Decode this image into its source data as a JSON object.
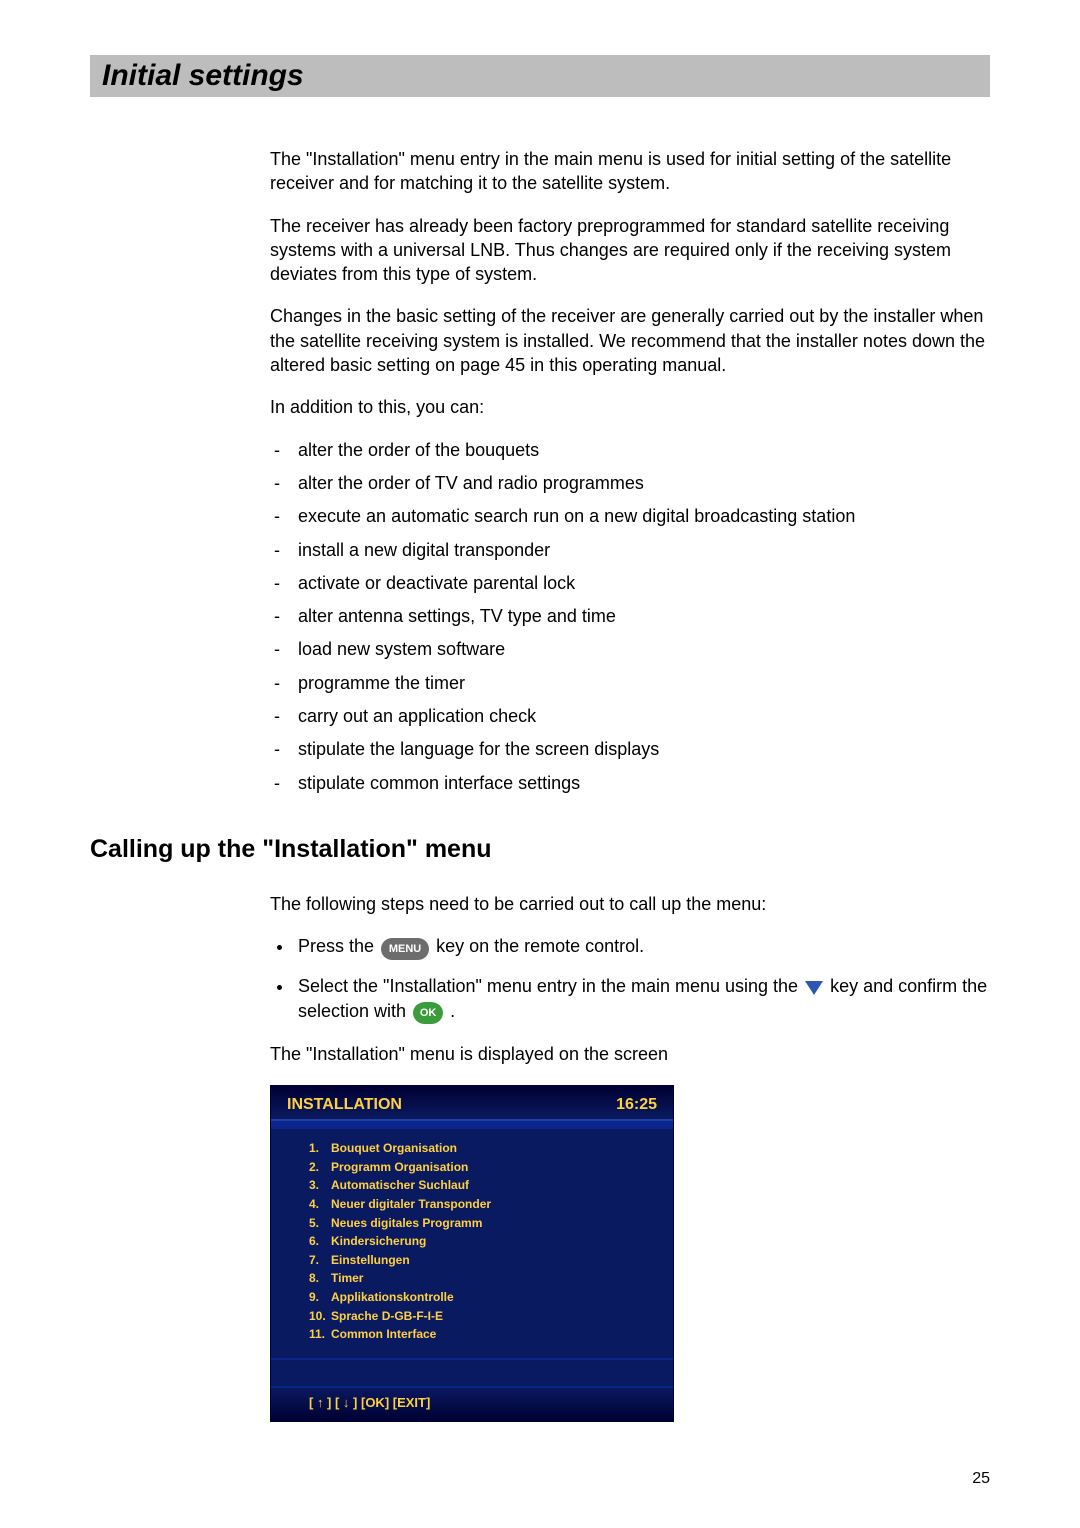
{
  "page": {
    "title": "Initial settings",
    "number": "25"
  },
  "intro": {
    "p1": "The \"Installation\" menu entry in the main menu is used for initial setting of the satellite receiver and for matching it to the satellite system.",
    "p2": "The receiver has already been factory preprogrammed for standard satellite receiving systems with a universal LNB. Thus changes are required only if the receiving system deviates from this type of system.",
    "p3": "Changes in the basic setting of the receiver are generally carried out by the installer when the satellite receiving system is installed. We recommend that the installer notes down the altered basic setting on page 45 in this operating manual.",
    "p4": "In addition to this, you can:"
  },
  "options": [
    "alter the order of the bouquets",
    "alter the order of TV and radio programmes",
    "execute an automatic search run on a new digital broadcasting station",
    "install a new digital transponder",
    "activate or deactivate parental lock",
    "alter antenna settings, TV type and time",
    "load new system software",
    "programme the timer",
    "carry out an application check",
    "stipulate the language for the screen displays",
    "stipulate common interface settings"
  ],
  "calling": {
    "heading": "Calling up the \"Installation\" menu",
    "intro": "The following steps need to be carried out to call up the menu:",
    "step1_a": "Press the ",
    "step1_b": " key on the remote control.",
    "step2_a": "Select the \"Installation\" menu entry in the main menu using the ",
    "step2_b": " key and confirm the selection with ",
    "step2_c": ".",
    "result": "The \"Installation\" menu is displayed on the screen"
  },
  "key_labels": {
    "menu": "MENU",
    "ok": "OK"
  },
  "tvmenu": {
    "title": "INSTALLATION",
    "time": "16:25",
    "items": [
      {
        "n": "1.",
        "label": "Bouquet Organisation"
      },
      {
        "n": "2.",
        "label": "Programm Organisation"
      },
      {
        "n": "3.",
        "label": "Automatischer Suchlauf"
      },
      {
        "n": "4.",
        "label": "Neuer digitaler Transponder"
      },
      {
        "n": "5.",
        "label": "Neues digitales Programm"
      },
      {
        "n": "6.",
        "label": "Kindersicherung"
      },
      {
        "n": "7.",
        "label": "Einstellungen"
      },
      {
        "n": "8.",
        "label": "Timer"
      },
      {
        "n": "9.",
        "label": "Applikationskontrolle"
      },
      {
        "n": "10.",
        "label": "Sprache D-GB-F-I-E"
      },
      {
        "n": "11.",
        "label": "Common Interface"
      }
    ],
    "footer": "[ ↑ ] [ ↓ ] [OK] [EXIT]"
  }
}
